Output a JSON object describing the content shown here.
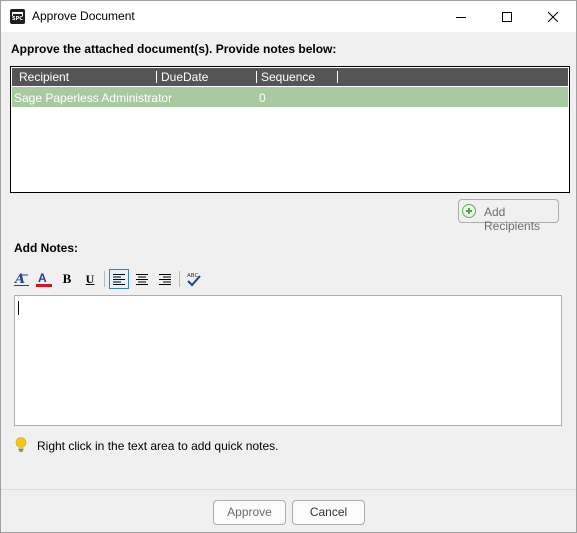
{
  "window": {
    "title": "Approve Document",
    "app_icon_text": "SPC",
    "controls": [
      "minimize-icon",
      "maximize-icon",
      "close-icon"
    ]
  },
  "instructions": "Approve the attached document(s). Provide notes below:",
  "recipients_grid": {
    "columns": [
      "Recipient",
      "DueDate",
      "Sequence"
    ],
    "rows": [
      {
        "recipient": "Sage Paperless Administrator",
        "due_date": "",
        "sequence": "0"
      }
    ],
    "selected_row_color": "#a9c9a0",
    "header_color": "#555555"
  },
  "add_recipients_label": "Add Recipients",
  "notes": {
    "label": "Add Notes:",
    "value": "",
    "toolbar": [
      "font-icon",
      "font-color-icon",
      "bold-icon",
      "underline-icon",
      "align-left-icon",
      "align-center-icon",
      "align-right-icon",
      "spellcheck-icon"
    ],
    "bold_glyph": "B",
    "underline_glyph": "U"
  },
  "tip": "Right click in the text area to add quick notes.",
  "buttons": {
    "approve": "Approve",
    "cancel": "Cancel"
  }
}
